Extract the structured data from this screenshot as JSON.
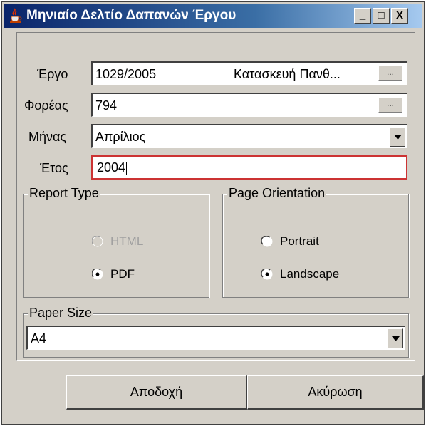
{
  "window": {
    "title": "Μηνιαίο Δελτίο Δαπανών Έργου",
    "minimize_glyph": "_",
    "maximize_glyph": "□",
    "close_glyph": "X"
  },
  "form": {
    "project": {
      "label": "Έργο",
      "code": "1029/2005",
      "description": "Κατασκευή Πανθ...",
      "lookup_label": "..."
    },
    "agency": {
      "label": "Φορέας",
      "value": "794",
      "lookup_label": "..."
    },
    "month": {
      "label": "Μήνας",
      "value": "Απρίλιος"
    },
    "year": {
      "label": "Έτος",
      "value": "2004"
    }
  },
  "report_type": {
    "legend": "Report Type",
    "options": [
      {
        "label": "HTML",
        "selected": false,
        "enabled": false
      },
      {
        "label": "PDF",
        "selected": true,
        "enabled": true
      }
    ]
  },
  "page_orientation": {
    "legend": "Page Orientation",
    "options": [
      {
        "label": "Portrait",
        "selected": false
      },
      {
        "label": "Landscape",
        "selected": true
      }
    ]
  },
  "paper_size": {
    "legend": "Paper Size",
    "value": "A4"
  },
  "buttons": {
    "accept": "Αποδοχή",
    "cancel": "Ακύρωση"
  },
  "colors": {
    "titlebar_start": "#0a246a",
    "titlebar_end": "#a6caf0",
    "window_bg": "#d4d0c8",
    "focus_border": "#cc3333"
  },
  "icons": {
    "app": "java-cup-icon",
    "dropdown": "chevron-down-icon"
  }
}
